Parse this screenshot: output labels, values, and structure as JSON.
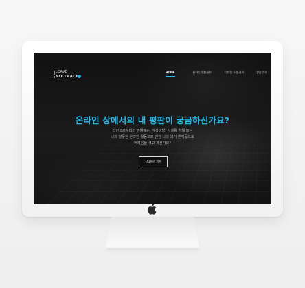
{
  "site": {
    "logo_line1": "LEAVE",
    "logo_line2": "NO TRACE.",
    "accent_color": "#2fb6e6"
  },
  "nav": {
    "items": [
      {
        "label": "HOME",
        "active": true
      },
      {
        "label": "온라인 평판 관리"
      },
      {
        "label": "디지털 유산 관리"
      },
      {
        "label": "상담문의"
      }
    ]
  },
  "hero": {
    "title": "온라인 상에서의 내 평판이 궁금하신가요?",
    "desc_lines": [
      "타인으로부터의 명예훼손, 악성비방, 사생활 침해 또는",
      "나의 잘못된 온라인 활동으로 인한 나의 과거 흔적들으로",
      "어려움을 겪고 계신가요?"
    ],
    "cta_label": "상담하러 가기"
  },
  "device": {
    "logo_icon": "apple-logo-icon"
  }
}
